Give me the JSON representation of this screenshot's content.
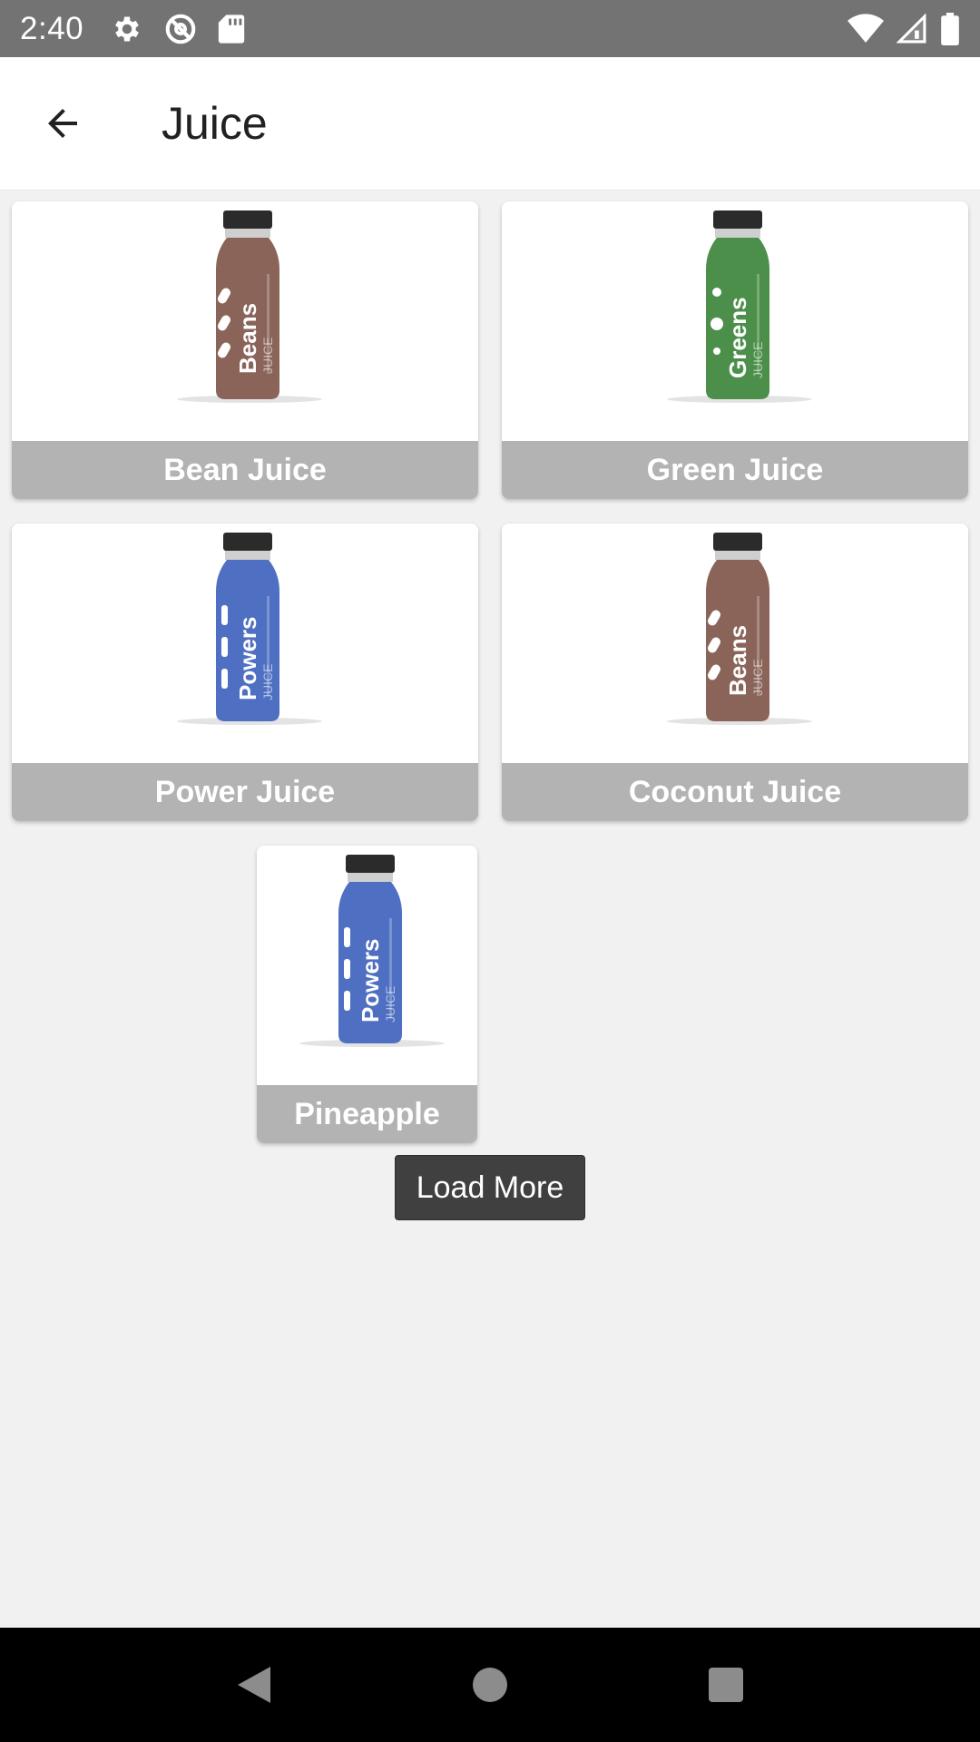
{
  "status_bar": {
    "time": "2:40",
    "icons": [
      "settings-icon",
      "sync-icon",
      "sd-card-icon",
      "wifi-icon",
      "signal-icon",
      "battery-icon"
    ]
  },
  "app_bar": {
    "back_icon": "arrow-back-icon",
    "title": "Juice"
  },
  "products": [
    {
      "name": "Bean Juice",
      "bottle_color": "#8a6458",
      "bottle_text": "Beans"
    },
    {
      "name": "Green Juice",
      "bottle_color": "#4c8f4a",
      "bottle_text": "Greens"
    },
    {
      "name": "Power Juice",
      "bottle_color": "#4e6fc2",
      "bottle_text": "Powers"
    },
    {
      "name": "Coconut Juice",
      "bottle_color": "#8a6458",
      "bottle_text": "Beans"
    },
    {
      "name": "Pineapple",
      "bottle_color": "#4e6fc2",
      "bottle_text": "Powers"
    }
  ],
  "bottle_subtext": "JUICE",
  "load_more_label": "Load More",
  "nav_bar": {
    "icons": [
      "back-triangle-icon",
      "home-circle-icon",
      "recents-square-icon"
    ]
  },
  "colors": {
    "status_bar": "#737373",
    "label_bg": "#b3b3b3",
    "button_bg": "#404040",
    "page_bg": "#f1f1f1"
  }
}
